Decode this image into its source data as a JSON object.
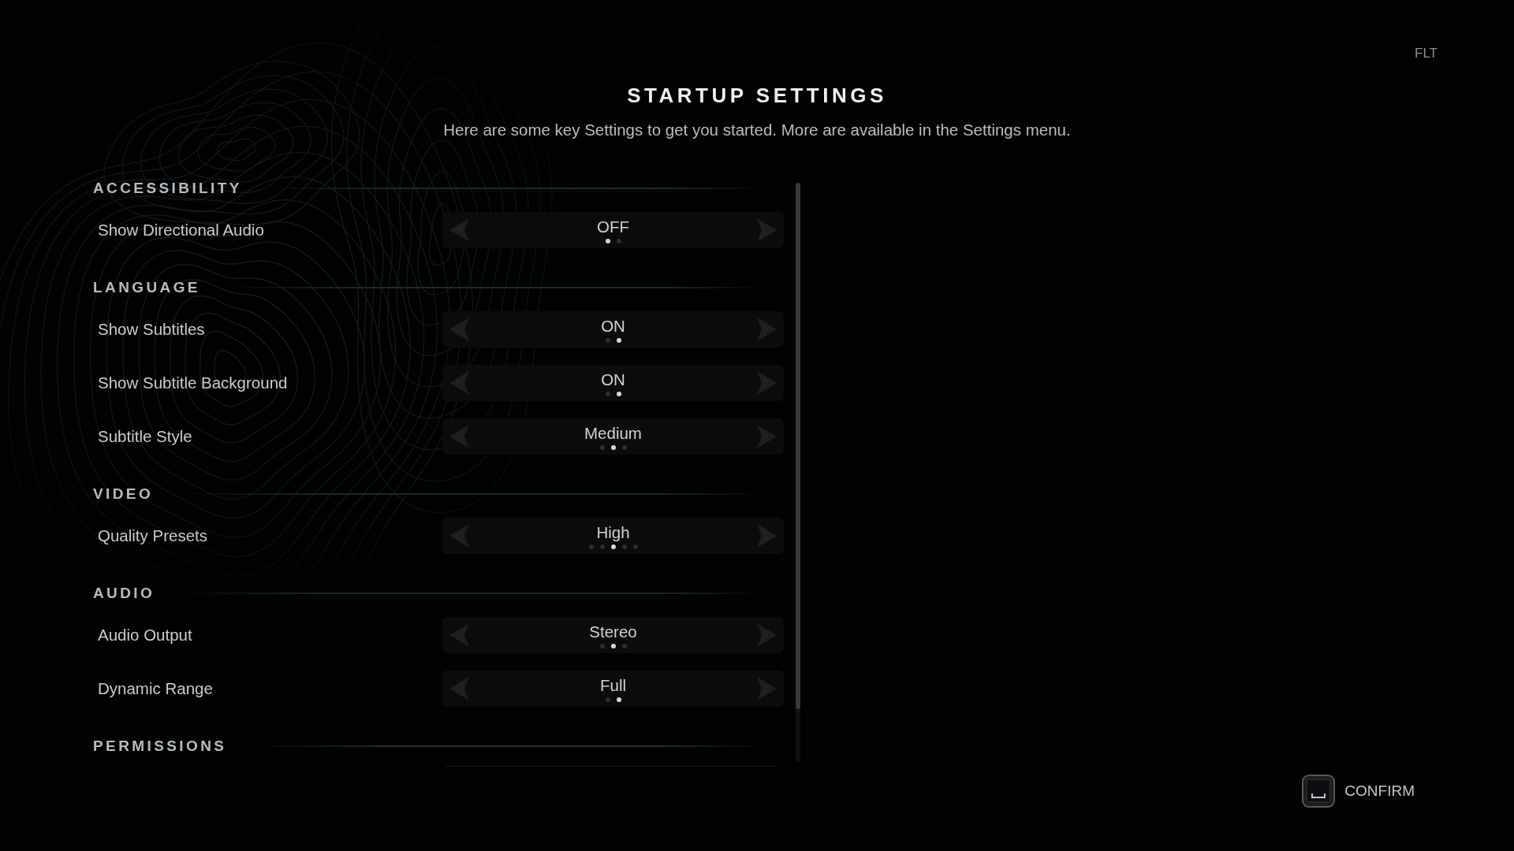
{
  "corner_label": "FLT",
  "title": "STARTUP SETTINGS",
  "subtitle": "Here are some key Settings to get you started. More are available in the Settings menu.",
  "sections": [
    {
      "title": "ACCESSIBILITY",
      "settings": [
        {
          "label": "Show Directional Audio",
          "value": "OFF",
          "option_dots": [
            {
              "selected": true
            },
            {
              "selected": false
            }
          ]
        }
      ]
    },
    {
      "title": "LANGUAGE",
      "settings": [
        {
          "label": "Show Subtitles",
          "value": "ON",
          "option_dots": [
            {
              "selected": false
            },
            {
              "selected": true
            }
          ]
        },
        {
          "label": "Show Subtitle Background",
          "value": "ON",
          "option_dots": [
            {
              "selected": false
            },
            {
              "selected": true
            }
          ]
        },
        {
          "label": "Subtitle Style",
          "value": "Medium",
          "option_dots": [
            {
              "selected": false
            },
            {
              "selected": true
            },
            {
              "selected": false
            }
          ]
        }
      ]
    },
    {
      "title": "VIDEO",
      "settings": [
        {
          "label": "Quality Presets",
          "value": "High",
          "option_dots": [
            {
              "selected": false
            },
            {
              "selected": false
            },
            {
              "selected": true
            },
            {
              "selected": false
            },
            {
              "selected": false
            }
          ]
        }
      ]
    },
    {
      "title": "AUDIO",
      "settings": [
        {
          "label": "Audio Output",
          "value": "Stereo",
          "option_dots": [
            {
              "selected": false
            },
            {
              "selected": true
            },
            {
              "selected": false
            }
          ]
        },
        {
          "label": "Dynamic Range",
          "value": "Full",
          "option_dots": [
            {
              "selected": false
            },
            {
              "selected": true
            }
          ]
        }
      ]
    },
    {
      "title": "PERMISSIONS"
    }
  ],
  "confirm_button": {
    "label": "CONFIRM"
  }
}
